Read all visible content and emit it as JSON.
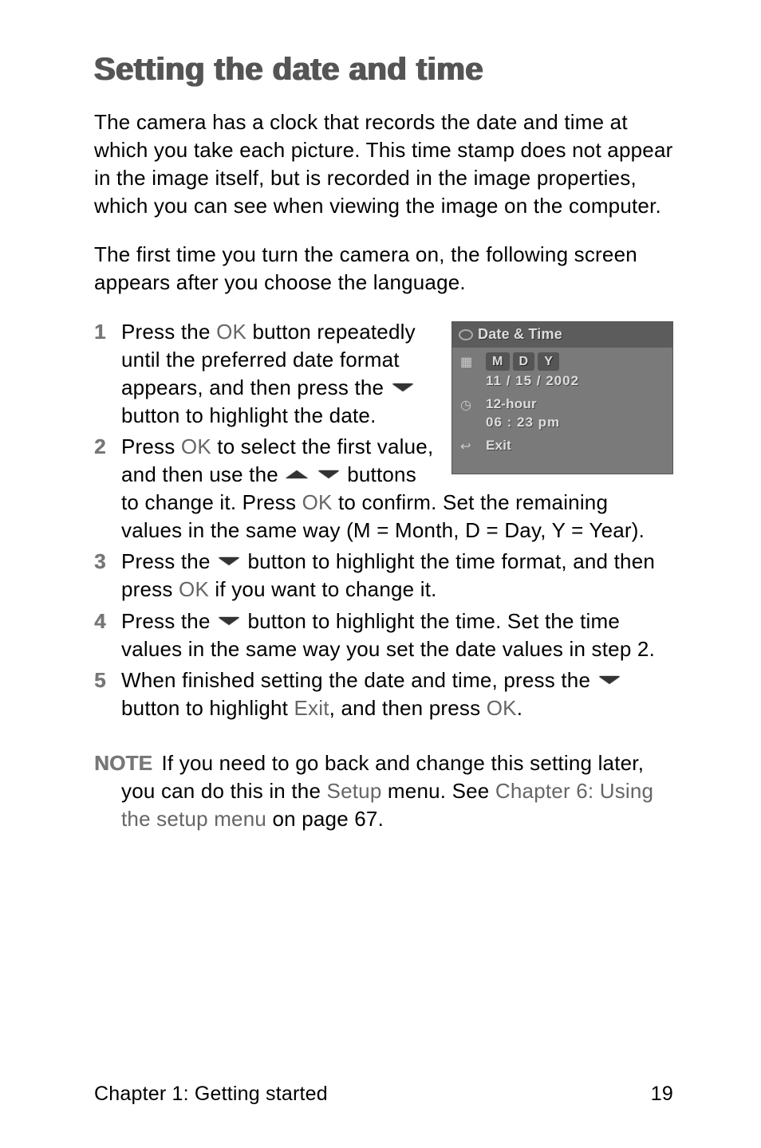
{
  "title": "Setting the date and time",
  "intro1": "The camera has a clock that records the date and time at which you take each picture. This time stamp does not appear in the image itself, but is recorded in the image properties, which you can see when viewing the image on the computer.",
  "intro2": "The first time you turn the camera on, the following screen appears after you choose the language.",
  "steps": {
    "s1a": "Press the ",
    "s1b": " button repeatedly until the preferred date format appears, and then press the ",
    "s1c": " button to highlight the date.",
    "s2a": "Press ",
    "s2b": " to select the first value, and then use the ",
    "s2c": " buttons to change it. Press ",
    "s2d": " to confirm. Set the remaining values in the same way (M = Month, D = Day, Y = Year).",
    "s3a": "Press the ",
    "s3b": " button to highlight the time format, and then press ",
    "s3c": " if you want to change it.",
    "s4a": "Press the ",
    "s4b": " button to highlight the time. Set the time values in the same way you set the date values in step 2.",
    "s5a": "When finished setting the date and time, press the ",
    "s5b": " button to highlight ",
    "s5c": ", and then press ",
    "s5d": "."
  },
  "ok_label": "OK",
  "exit_ref": "Exit",
  "note": {
    "label": "NOTE",
    "a": "If you need to go back and change this setting later, you can do this in the ",
    "setup": "Setup",
    "b": " menu. See ",
    "chapter_ref": "Chapter 6: Using the setup menu",
    "c": " on page 67."
  },
  "figure": {
    "title": "Date & Time",
    "mdy": [
      "M",
      "D",
      "Y"
    ],
    "date_value": "11 / 15 / 2002",
    "hour_fmt": "12-hour",
    "time_value": "06 : 23 pm",
    "exit": "Exit"
  },
  "footer": {
    "chapter": "Chapter 1: Getting started",
    "page": "19"
  }
}
